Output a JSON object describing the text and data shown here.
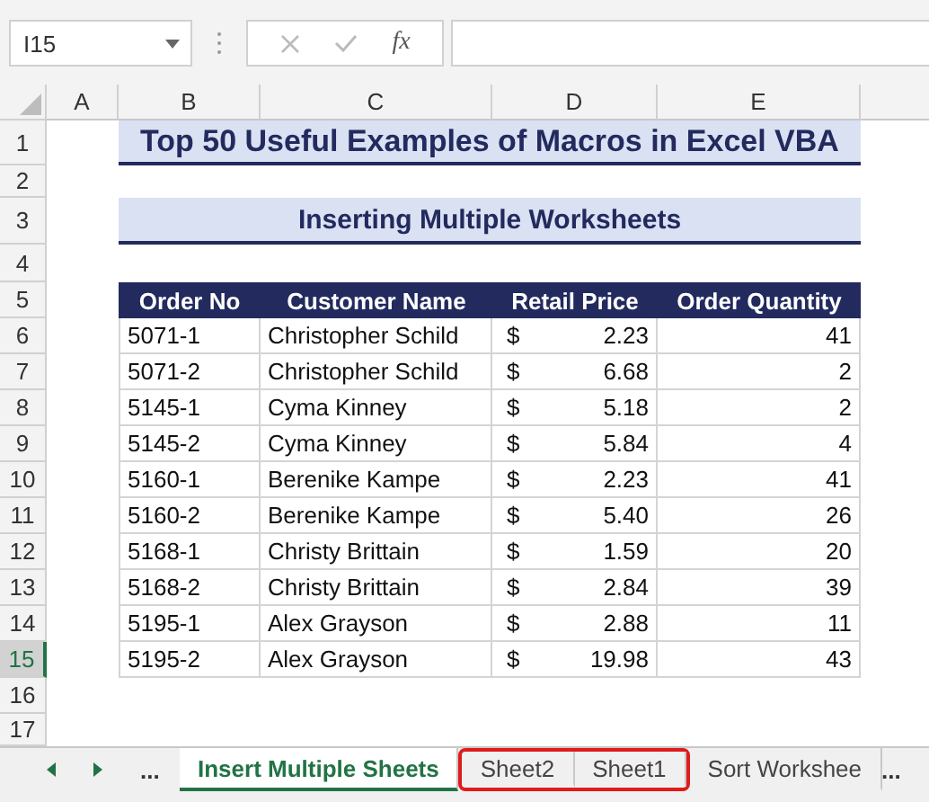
{
  "formula_bar": {
    "name_box": "I15",
    "function_label": "fx"
  },
  "columns": [
    {
      "label": "A"
    },
    {
      "label": "B"
    },
    {
      "label": "C"
    },
    {
      "label": "D"
    },
    {
      "label": "E"
    }
  ],
  "row_headers": [
    {
      "label": "1",
      "selected": false
    },
    {
      "label": "2",
      "selected": false
    },
    {
      "label": "3",
      "selected": false
    },
    {
      "label": "4",
      "selected": false
    },
    {
      "label": "5",
      "selected": false
    },
    {
      "label": "6",
      "selected": false
    },
    {
      "label": "7",
      "selected": false
    },
    {
      "label": "8",
      "selected": false
    },
    {
      "label": "9",
      "selected": false
    },
    {
      "label": "10",
      "selected": false
    },
    {
      "label": "11",
      "selected": false
    },
    {
      "label": "12",
      "selected": false
    },
    {
      "label": "13",
      "selected": false
    },
    {
      "label": "14",
      "selected": false
    },
    {
      "label": "15",
      "selected": true
    },
    {
      "label": "16",
      "selected": false
    },
    {
      "label": "17",
      "selected": false
    }
  ],
  "title": "Top 50 Useful Examples of Macros in Excel VBA",
  "subtitle": "Inserting Multiple Worksheets",
  "table": {
    "columns": [
      "Order No",
      "Customer Name",
      "Retail Price",
      "Order Quantity"
    ],
    "rows": [
      {
        "order_no": "5071-1",
        "customer": "Christopher Schild",
        "currency": "$",
        "price": "2.23",
        "quantity": "41"
      },
      {
        "order_no": "5071-2",
        "customer": "Christopher Schild",
        "currency": "$",
        "price": "6.68",
        "quantity": "2"
      },
      {
        "order_no": "5145-1",
        "customer": "Cyma Kinney",
        "currency": "$",
        "price": "5.18",
        "quantity": "2"
      },
      {
        "order_no": "5145-2",
        "customer": "Cyma Kinney",
        "currency": "$",
        "price": "5.84",
        "quantity": "4"
      },
      {
        "order_no": "5160-1",
        "customer": "Berenike Kampe",
        "currency": "$",
        "price": "2.23",
        "quantity": "41"
      },
      {
        "order_no": "5160-2",
        "customer": "Berenike Kampe",
        "currency": "$",
        "price": "5.40",
        "quantity": "26"
      },
      {
        "order_no": "5168-1",
        "customer": "Christy Brittain",
        "currency": "$",
        "price": "1.59",
        "quantity": "20"
      },
      {
        "order_no": "5168-2",
        "customer": "Christy Brittain",
        "currency": "$",
        "price": "2.84",
        "quantity": "39"
      },
      {
        "order_no": "5195-1",
        "customer": "Alex Grayson",
        "currency": "$",
        "price": "2.88",
        "quantity": "11"
      },
      {
        "order_no": "5195-2",
        "customer": "Alex Grayson",
        "currency": "$",
        "price": "19.98",
        "quantity": "43"
      }
    ]
  },
  "sheet_tabs": {
    "more_left": "...",
    "tabs": [
      {
        "label": "Insert Multiple Sheets",
        "selected": true,
        "highlighted": false
      },
      {
        "label": "Sheet2",
        "selected": false,
        "highlighted": true
      },
      {
        "label": "Sheet1",
        "selected": false,
        "highlighted": true
      },
      {
        "label": "Sort Workshee",
        "selected": false,
        "highlighted": false
      }
    ],
    "more_right": "..."
  }
}
